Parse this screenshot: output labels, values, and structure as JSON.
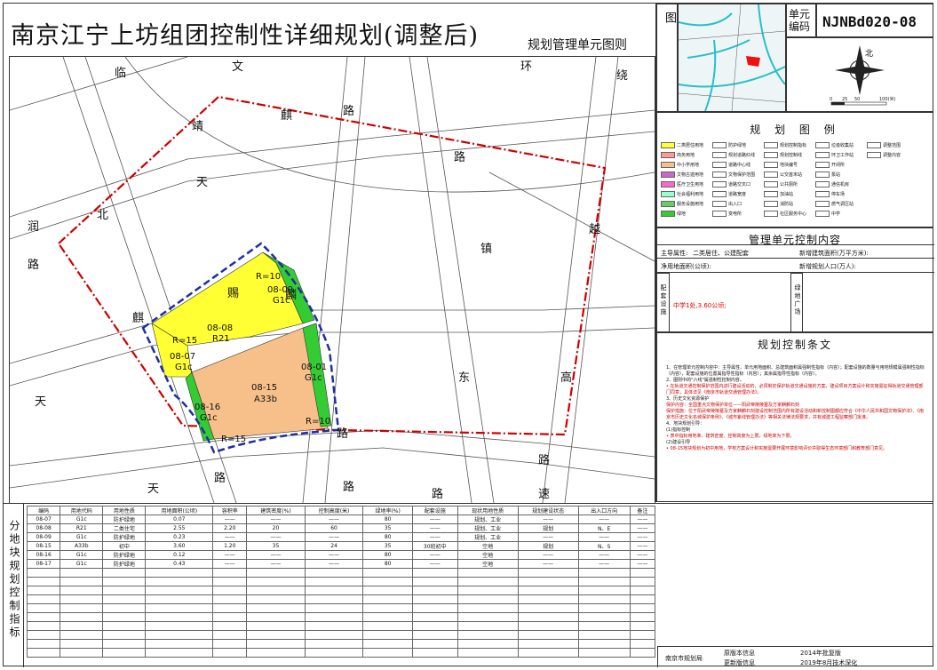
{
  "title": "南京江宁上坊组团控制性详细规划(调整后)",
  "subtitle": "规划管理单元图则",
  "unit_code_label": "单元编码",
  "unit_code": "NJNBd020-08",
  "location_label": "管理单元区位图",
  "north_label": "北",
  "scale_labels": [
    "0",
    "25",
    "50",
    "100(米)"
  ],
  "legend_title": "规 划 图 例",
  "legend_items": [
    "二类居住用地",
    "商务用地",
    "中小学用地",
    "文物古迹用地",
    "医疗卫生用地",
    "社会福利用地",
    "服务设施用地",
    "绿地",
    "防护绿地",
    "规划道路红线",
    "道路中心线",
    "文物保护范围",
    "道路交叉口",
    "道路宽度",
    "出入口",
    "变电所",
    "规划控制指标",
    "规划控制线",
    "地块编号",
    "公交首末站",
    "公共厕所",
    "加油站",
    "消防站",
    "社区服务中心",
    "垃圾收集站",
    "环卫工作站",
    "开闭所",
    "泵站",
    "通信机房",
    "停车场",
    "燃气调压站",
    "中学",
    "调整范围",
    "调整内容"
  ],
  "map_labels": {
    "roads": [
      "临",
      "文",
      "环",
      "绕",
      "靖",
      "麒",
      "路",
      "天",
      "润",
      "北",
      "路",
      "麒",
      "东",
      "高",
      "镇",
      "越",
      "天",
      "路",
      "路",
      "路",
      "速",
      "路",
      "路",
      "天",
      "赐",
      "麟",
      "路"
    ],
    "parcels": [
      {
        "code": "08-08",
        "use": "R21"
      },
      {
        "code": "08-09",
        "use": "G1c"
      },
      {
        "code": "08-07",
        "use": "G1c"
      },
      {
        "code": "08-15",
        "use": "A33b"
      },
      {
        "code": "08-01",
        "use": "G1c"
      },
      {
        "code": "08-16",
        "use": "G1c"
      }
    ],
    "radii": [
      "R=10",
      "R=15",
      "R=10",
      "R=15"
    ]
  },
  "control_title": "管理单元控制内容",
  "control": {
    "main_use_label": "主导属性:",
    "main_use": "二类居住、公建配套",
    "new_area_label": "新增建筑面积(万平方米):",
    "net_area_label": "净用地面积(公顷):",
    "new_pop_label": "新增规划人口(万人):",
    "facility_label": "配套设施",
    "facility": "中学1处,3.60公顷;",
    "green_label": "绿地广场"
  },
  "rules_title": "规划控制条文",
  "rules": [
    "1、在管理单元控制内容中：主导属性、单元用地面积、总建筑面积属强制性指标（内容）；配套设施的数量与用地规模属强制性指标（内容），配套设施的位置属指导性指标（内容）；其余属指导性指标（内容）。",
    "2、图则中的\"六线\"属强制性控制内容。",
    "• 在轨道交通控制保护范围内进行建设活动的，必须制定保护轨道交通设施的方案，建设项目方案设计和实施需征得轨道交通管理部门同意，具体详见《南京市轨道交通管理办法》。",
    "3、历史文化资源保护",
    "保护内容：全国重点文物保护单位——阳武帝陵陵墓及方家麒麟石刻",
    "保护措施：位于阳武帝陵陵墓及方家麒麟石刻建设控制范围内所有建设活动和新控制图都应符合《中华人民共和国文物保护法》、《南京市历史文化名城保护条例》、《城市紫线管理办法》等相关法律法规要求，并有城建工程监察部门批准。",
    "4、地块规划引导：",
    "(1)指标控制",
    "• 表中指标用地率、建筑密度、控制高度为上限，绿地率为下限。",
    "(2)建设引导",
    "• 08-15地块规划为初中用地，学校方案设计和实施需要开展环境影响评价并取得生态环境部门和教育部门意见。"
  ],
  "table_title_vertical": "分地块规划控制指标",
  "table": {
    "headers": [
      "编码",
      "用地代码",
      "用地性质",
      "用地面积(公顷)",
      "容积率",
      "建筑密度(%)",
      "控制高度(米)",
      "绿地率(%)",
      "配套设施",
      "现状用地性质",
      "规划建设状态",
      "出入口方向",
      "备注"
    ],
    "rows": [
      [
        "08-07",
        "G1c",
        "防护绿地",
        "0.07",
        "——",
        "——",
        "——",
        "80",
        "——",
        "规划、工业",
        "——",
        "——",
        "——"
      ],
      [
        "08-08",
        "R21",
        "二类住宅",
        "2.55",
        "2.20",
        "20",
        "60",
        "35",
        "——",
        "规划、工业",
        "规划",
        "N、E",
        "——"
      ],
      [
        "08-09",
        "G1c",
        "防护绿地",
        "0.23",
        "——",
        "——",
        "——",
        "80",
        "——",
        "规划、工业",
        "——",
        "——",
        "——"
      ],
      [
        "08-15",
        "A33b",
        "初中",
        "3.60",
        "1.20",
        "35",
        "24",
        "35",
        "30班初中",
        "空地",
        "规划",
        "N、S",
        "——"
      ],
      [
        "08-16",
        "G1c",
        "防护绿地",
        "0.12",
        "——",
        "——",
        "——",
        "80",
        "——",
        "空地",
        "——",
        "——",
        "——"
      ],
      [
        "08-17",
        "G1c",
        "防护绿地",
        "0.43",
        "——",
        "——",
        "——",
        "80",
        "——",
        "空地",
        "——",
        "——",
        "——"
      ]
    ]
  },
  "footer": {
    "agency": "南京市规划局",
    "original_label": "原版本信息",
    "original_value": "2014年批复版",
    "update_label": "更新版信息",
    "update_value": "2019年8月技术深化"
  },
  "colors": {
    "residential": "#ffff33",
    "school": "#f7c08a",
    "green": "#33cc33",
    "boundary": "#cc0000",
    "adjust": "#1f2f9f"
  }
}
